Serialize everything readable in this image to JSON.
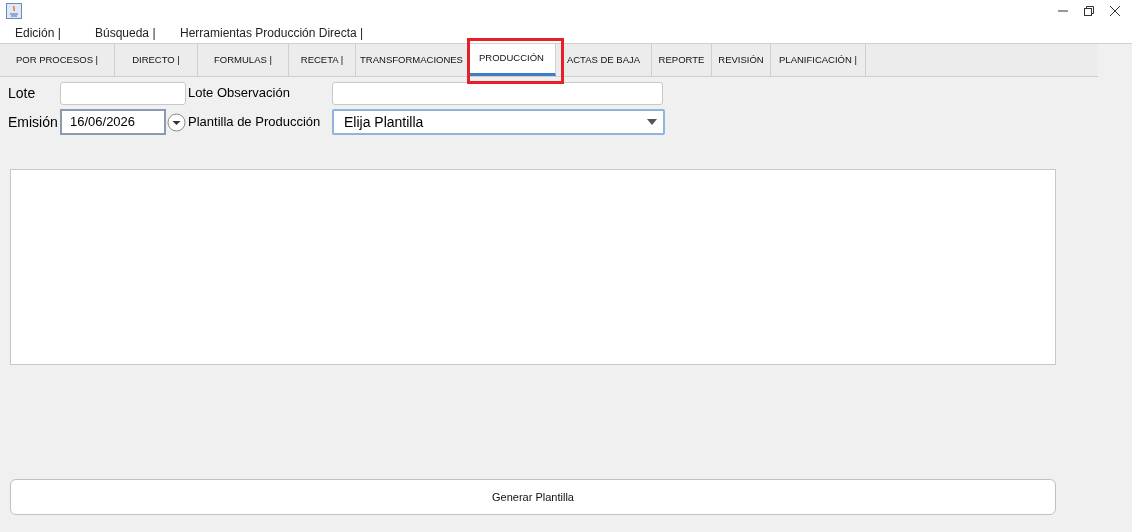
{
  "menu": [
    "Edición |",
    "Búsqueda |",
    "Herramientas Producción Directa |"
  ],
  "tabs": [
    {
      "label": "POR PROCESOS |",
      "selected": false
    },
    {
      "label": "DIRECTO |",
      "selected": false
    },
    {
      "label": "FORMULAS |",
      "selected": false
    },
    {
      "label": "RECETA |",
      "selected": false
    },
    {
      "label": "TRANSFORMACIONES",
      "selected": false
    },
    {
      "label": "PRODUCCIÓN",
      "selected": true,
      "highlighted": true
    },
    {
      "label": "ACTAS DE BAJA",
      "selected": false
    },
    {
      "label": "REPORTE",
      "selected": false
    },
    {
      "label": "REVISIÓN",
      "selected": false
    },
    {
      "label": "PLANIFICACIÓN |",
      "selected": false
    }
  ],
  "form": {
    "lote_label": "Lote",
    "lote_observacion_label": "Lote Observación",
    "emision_label": "Emisión",
    "emision_value": "16/06/2026",
    "plantilla_label": "Plantilla de Producción",
    "plantilla_value": "Elija Plantilla"
  },
  "generate_button": "Generar Plantilla"
}
